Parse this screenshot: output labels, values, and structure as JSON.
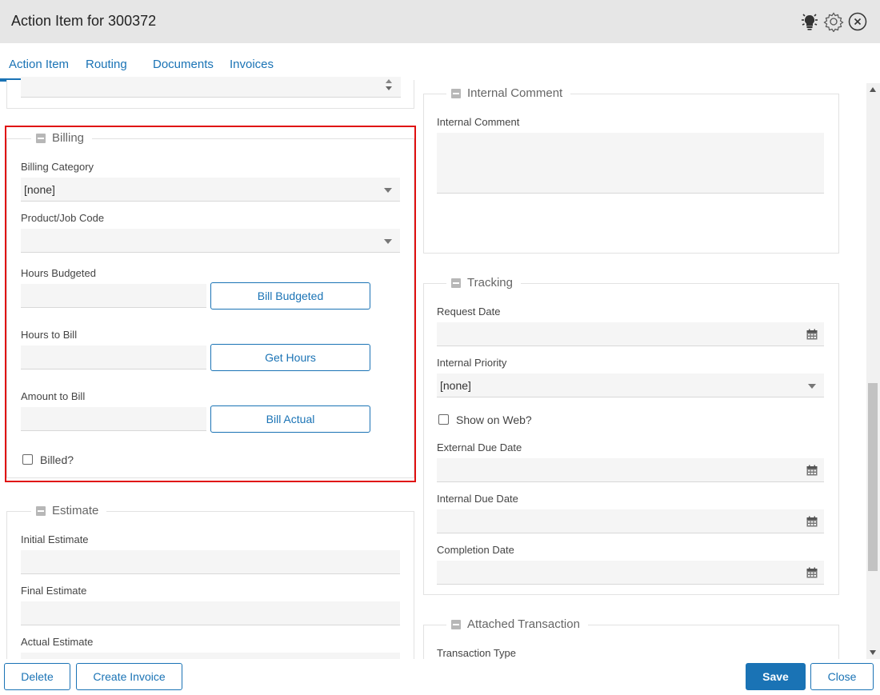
{
  "window": {
    "title": "Action Item for 300372"
  },
  "toolbar": {
    "icons": [
      "lightbulb-icon",
      "gear-icon",
      "close-icon"
    ]
  },
  "tabs": [
    {
      "label": "Action Item",
      "active": true
    },
    {
      "label": "Routing"
    },
    {
      "label": "Documents"
    },
    {
      "label": "Invoices"
    }
  ],
  "billing": {
    "legend": "Billing",
    "billing_category_label": "Billing Category",
    "billing_category_value": "[none]",
    "product_job_code_label": "Product/Job Code",
    "product_job_code_value": "",
    "hours_budgeted_label": "Hours Budgeted",
    "bill_budgeted_button": "Bill Budgeted",
    "hours_to_bill_label": "Hours to Bill",
    "get_hours_button": "Get Hours",
    "amount_to_bill_label": "Amount to Bill",
    "bill_actual_button": "Bill Actual",
    "billed_label": "Billed?",
    "billed_checked": false
  },
  "estimate": {
    "legend": "Estimate",
    "initial_label": "Initial Estimate",
    "final_label": "Final Estimate",
    "actual_label": "Actual Estimate"
  },
  "internal_comment": {
    "legend": "Internal Comment",
    "label": "Internal Comment",
    "value": ""
  },
  "tracking": {
    "legend": "Tracking",
    "request_date_label": "Request Date",
    "internal_priority_label": "Internal Priority",
    "internal_priority_value": "[none]",
    "show_on_web_label": "Show on Web?",
    "show_on_web_checked": false,
    "external_due_date_label": "External Due Date",
    "internal_due_date_label": "Internal Due Date",
    "completion_date_label": "Completion Date"
  },
  "attached_transaction": {
    "legend": "Attached Transaction",
    "transaction_type_label": "Transaction Type"
  },
  "footer": {
    "delete_label": "Delete",
    "create_invoice_label": "Create Invoice",
    "save_label": "Save",
    "close_label": "Close"
  },
  "colors": {
    "accent": "#1a73b5",
    "highlight": "#e01010"
  }
}
